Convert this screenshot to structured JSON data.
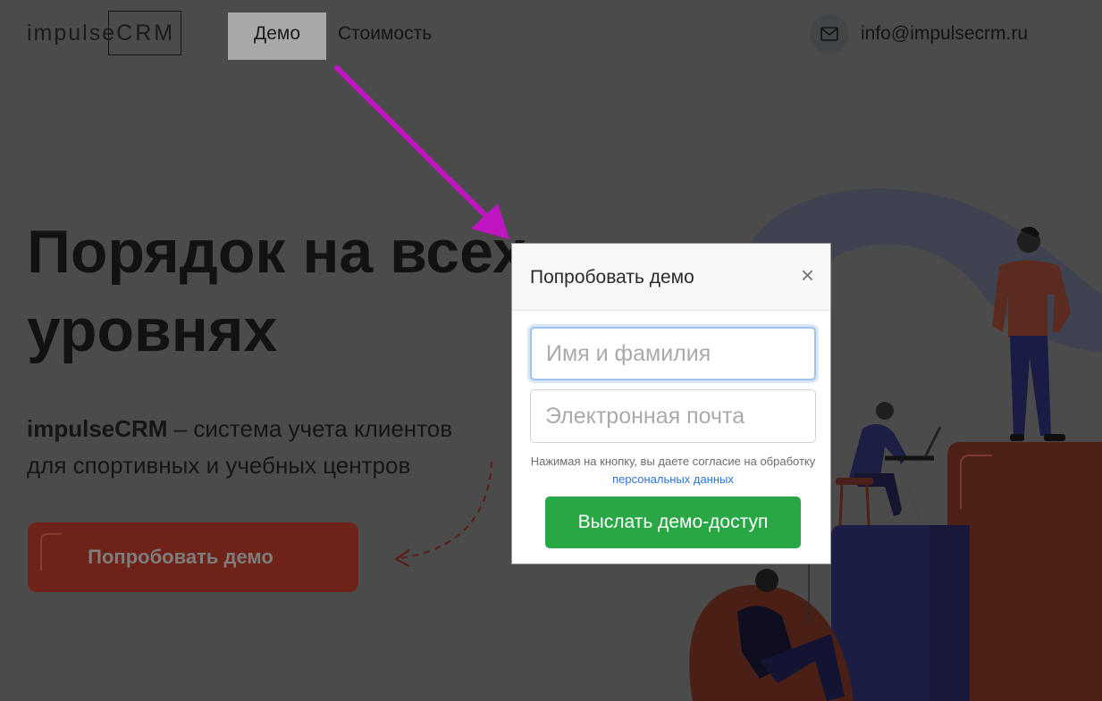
{
  "header": {
    "logo": {
      "part1": "impulse",
      "part2": "CRM"
    },
    "nav": {
      "demo": "Демо",
      "pricing": "Стоимость"
    },
    "email": "info@impulsecrm.ru"
  },
  "hero": {
    "title_line1": "Порядок на всех",
    "title_line2": "уровнях",
    "subtitle_brand": "impulseCRM",
    "subtitle_rest": " – система учета клиентов",
    "subtitle_line2": "для спортивных и учебных центров",
    "cta": "Попробовать демо"
  },
  "modal": {
    "title": "Попробовать демо",
    "close": "×",
    "name_placeholder": "Имя и фамилия",
    "email_placeholder": "Электронная почта",
    "consent_text": "Нажимая на кнопку, вы даете согласие на обработку ",
    "consent_link": "персональных данных",
    "submit": "Выслать демо-доступ"
  },
  "colors": {
    "overlay_bg": "#4b4b4b",
    "submit_green": "#2aa745",
    "annotation_arrow": "#c215c2",
    "hero_button": "#6e2218"
  }
}
